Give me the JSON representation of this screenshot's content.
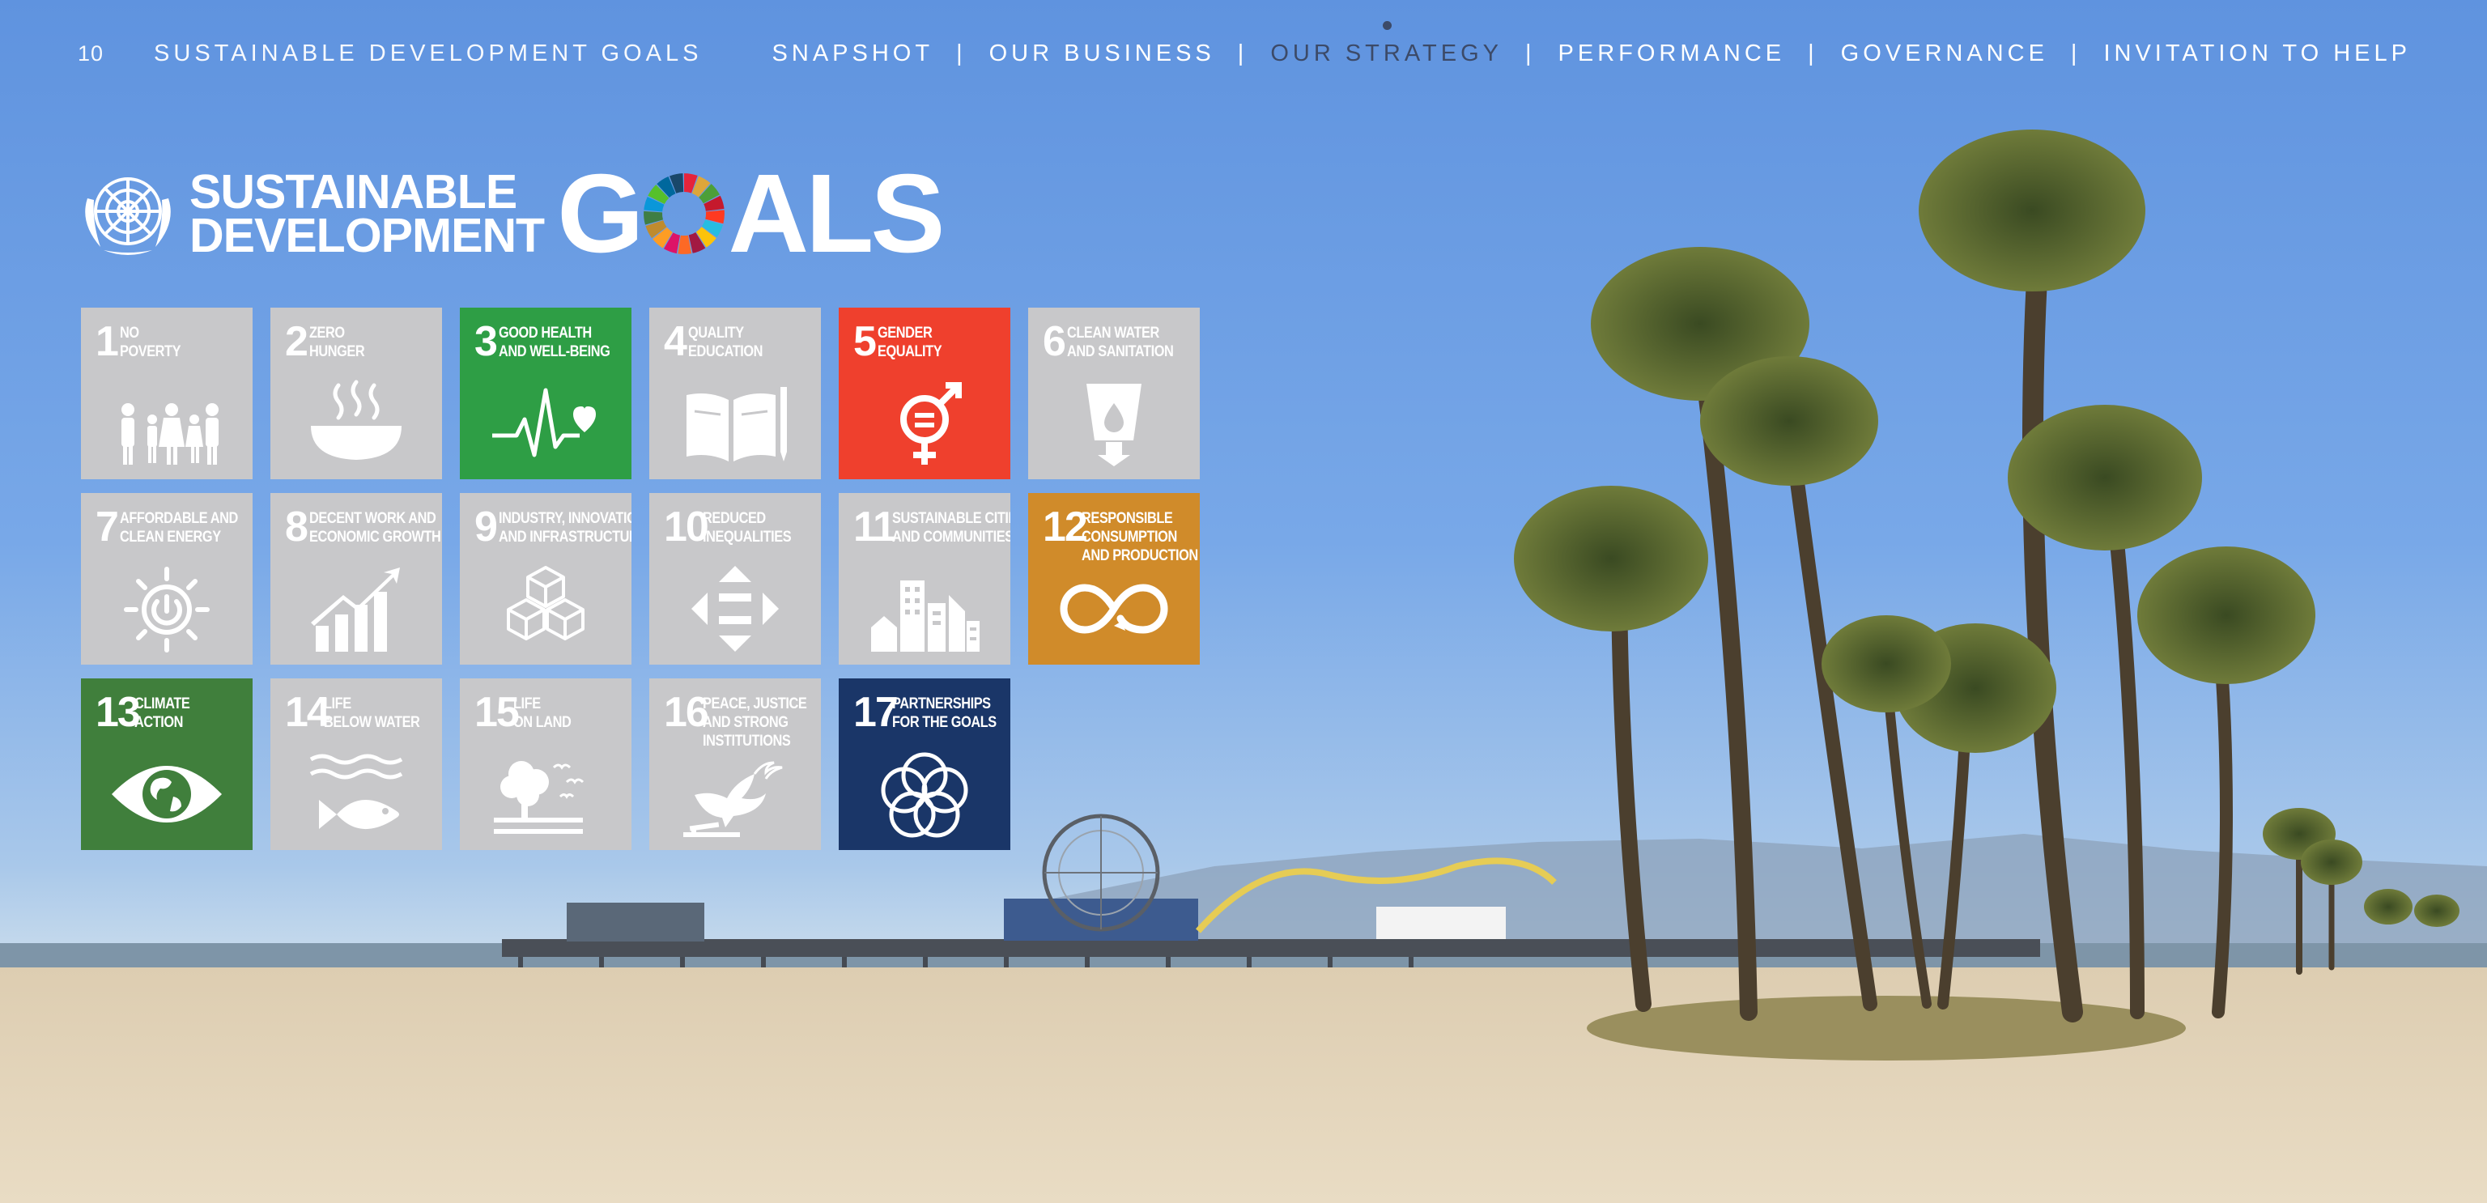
{
  "header": {
    "page_number": "10",
    "section_title": "SUSTAINABLE DEVELOPMENT GOALS",
    "nav": [
      {
        "label": "SNAPSHOT",
        "active": false
      },
      {
        "label": "OUR BUSINESS",
        "active": false
      },
      {
        "label": "OUR STRATEGY",
        "active": true
      },
      {
        "label": "PERFORMANCE",
        "active": false
      },
      {
        "label": "GOVERNANCE",
        "active": false
      },
      {
        "label": "INVITATION TO HELP",
        "active": false
      }
    ],
    "separator": "|"
  },
  "logo": {
    "line1": "SUSTAINABLE",
    "line2": "DEVELOPMENT",
    "goals_before": "G",
    "goals_after": "ALS"
  },
  "colors": {
    "tile_inactive": "#c8c8ca",
    "goal_3": "#2e9e45",
    "goal_5": "#ef402d",
    "goal_12": "#d08b2a",
    "goal_13": "#407f3c",
    "goal_17": "#1a3668",
    "sky_top": "#5f93df",
    "sand": "#e5d7bd"
  },
  "goals": [
    {
      "number": "1",
      "label_lines": [
        "NO",
        "POVERTY"
      ],
      "highlighted": false,
      "icon": "people-icon"
    },
    {
      "number": "2",
      "label_lines": [
        "ZERO",
        "HUNGER"
      ],
      "highlighted": false,
      "icon": "bowl-icon"
    },
    {
      "number": "3",
      "label_lines": [
        "GOOD HEALTH",
        "AND WELL-BEING"
      ],
      "highlighted": true,
      "icon": "heartbeat-icon"
    },
    {
      "number": "4",
      "label_lines": [
        "QUALITY",
        "EDUCATION"
      ],
      "highlighted": false,
      "icon": "book-icon"
    },
    {
      "number": "5",
      "label_lines": [
        "GENDER",
        "EQUALITY"
      ],
      "highlighted": true,
      "icon": "gender-equality-icon"
    },
    {
      "number": "6",
      "label_lines": [
        "CLEAN WATER",
        "AND SANITATION"
      ],
      "highlighted": false,
      "icon": "water-glass-icon"
    },
    {
      "number": "7",
      "label_lines": [
        "AFFORDABLE AND",
        "CLEAN ENERGY"
      ],
      "highlighted": false,
      "icon": "sun-power-icon"
    },
    {
      "number": "8",
      "label_lines": [
        "DECENT WORK AND",
        "ECONOMIC GROWTH"
      ],
      "highlighted": false,
      "icon": "growth-chart-icon"
    },
    {
      "number": "9",
      "label_lines": [
        "INDUSTRY, INNOVATION",
        "AND INFRASTRUCTURE"
      ],
      "highlighted": false,
      "icon": "cubes-icon"
    },
    {
      "number": "10",
      "label_lines": [
        "REDUCED",
        "INEQUALITIES"
      ],
      "highlighted": false,
      "icon": "equality-arrows-icon"
    },
    {
      "number": "11",
      "label_lines": [
        "SUSTAINABLE CITIES",
        "AND COMMUNITIES"
      ],
      "highlighted": false,
      "icon": "city-icon"
    },
    {
      "number": "12",
      "label_lines": [
        "RESPONSIBLE",
        "CONSUMPTION",
        "AND PRODUCTION"
      ],
      "highlighted": true,
      "icon": "infinity-icon"
    },
    {
      "number": "13",
      "label_lines": [
        "CLIMATE",
        "ACTION"
      ],
      "highlighted": true,
      "icon": "eye-globe-icon"
    },
    {
      "number": "14",
      "label_lines": [
        "LIFE",
        "BELOW WATER"
      ],
      "highlighted": false,
      "icon": "fish-icon"
    },
    {
      "number": "15",
      "label_lines": [
        "LIFE",
        "ON LAND"
      ],
      "highlighted": false,
      "icon": "tree-birds-icon"
    },
    {
      "number": "16",
      "label_lines": [
        "PEACE, JUSTICE",
        "AND STRONG",
        "INSTITUTIONS"
      ],
      "highlighted": false,
      "icon": "dove-gavel-icon"
    },
    {
      "number": "17",
      "label_lines": [
        "PARTNERSHIPS",
        "FOR THE GOALS"
      ],
      "highlighted": true,
      "icon": "rings-icon"
    }
  ]
}
